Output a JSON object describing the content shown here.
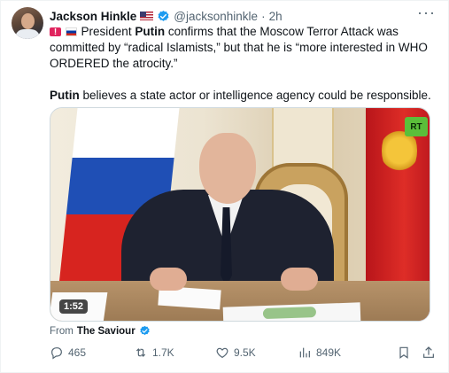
{
  "author": {
    "name": "Jackson Hinkle",
    "handle": "@jacksonhinkle",
    "separator": "·",
    "time": "2h",
    "more": "···"
  },
  "tweet": {
    "p1_pre": "President ",
    "p1_bold": "Putin",
    "p1_post": " confirms that the Moscow Terror Attack was committed by “radical Islamists,” but that he is “more interested in WHO ORDERED the atrocity.”",
    "p2_bold": "Putin",
    "p2_post": " believes a state actor or intelligence agency could be responsible."
  },
  "media": {
    "logo_text": "RT",
    "duration": "1:52"
  },
  "from": {
    "prefix": "From",
    "source": "The Saviour"
  },
  "actions": {
    "replies": "465",
    "reposts": "1.7K",
    "likes": "9.5K",
    "views": "849K"
  },
  "icons": {
    "verified": "verified-badge-icon",
    "reply": "reply-icon",
    "repost": "repost-icon",
    "like": "heart-icon",
    "views": "views-chart-icon",
    "bookmark": "bookmark-icon",
    "share": "share-icon"
  },
  "colors": {
    "verified_blue": "#1d9bf0",
    "muted_text": "#536471",
    "text": "#0f1419"
  }
}
